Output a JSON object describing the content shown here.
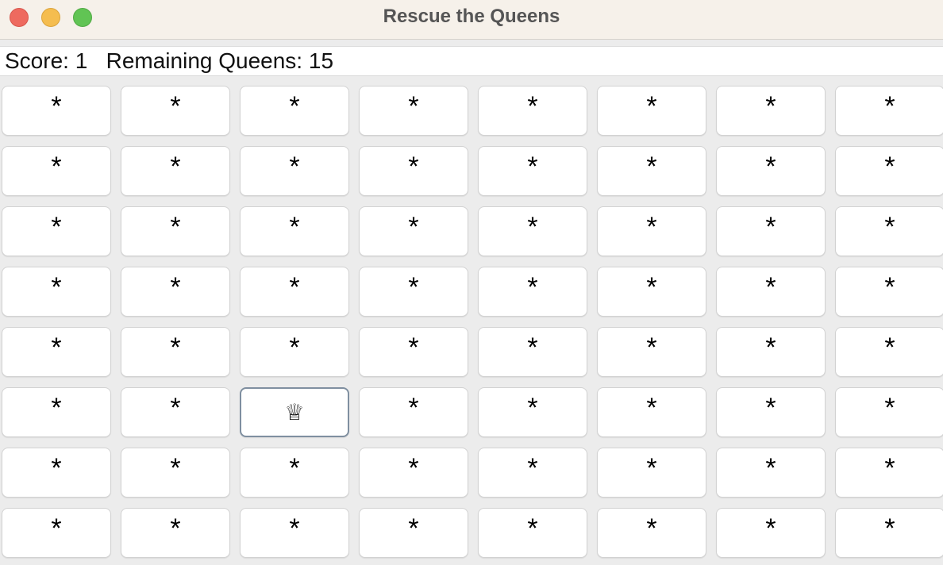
{
  "window": {
    "title": "Rescue the Queens"
  },
  "status": {
    "text": "Score: 1   Remaining Queens: 15"
  },
  "board": {
    "rows": [
      [
        "*",
        "*",
        "*",
        "*",
        "*",
        "*",
        "*",
        "*"
      ],
      [
        "*",
        "*",
        "*",
        "*",
        "*",
        "*",
        "*",
        "*"
      ],
      [
        "*",
        "*",
        "*",
        "*",
        "*",
        "*",
        "*",
        "*"
      ],
      [
        "*",
        "*",
        "*",
        "*",
        "*",
        "*",
        "*",
        "*"
      ],
      [
        "*",
        "*",
        "*",
        "*",
        "*",
        "*",
        "*",
        "*"
      ],
      [
        "*",
        "*",
        "♕",
        "*",
        "*",
        "*",
        "*",
        "*"
      ],
      [
        "*",
        "*",
        "*",
        "*",
        "*",
        "*",
        "*",
        "*"
      ],
      [
        "*",
        "*",
        "*",
        "*",
        "*",
        "*",
        "*",
        "*"
      ]
    ]
  }
}
